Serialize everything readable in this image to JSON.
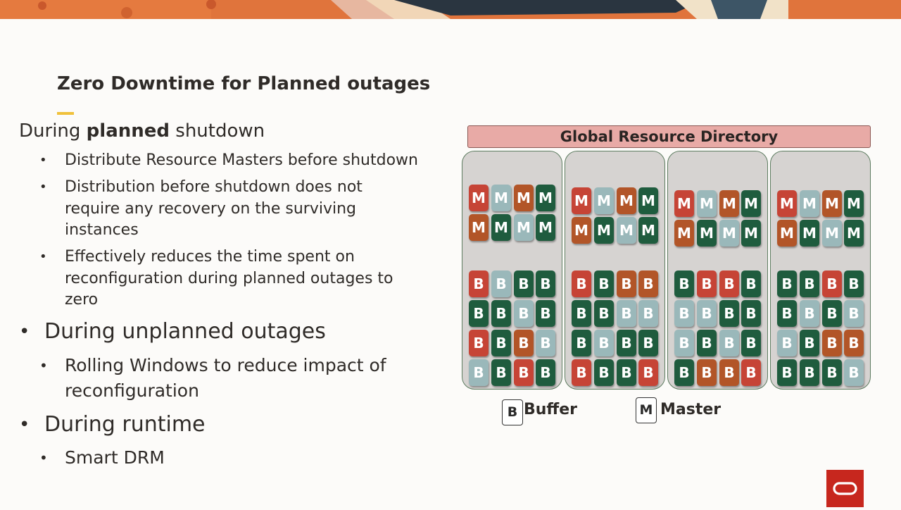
{
  "slide": {
    "title": "Zero Downtime for Planned outages",
    "lead_prefix": "During ",
    "lead_bold": "planned",
    "lead_suffix": " shutdown",
    "sub_bullets_planned": [
      "Distribute Resource Masters before shutdown",
      [
        "Distribution before shutdown does not",
        "require any recovery on the surviving",
        "instances"
      ],
      [
        "Effectively reduces the time spent on",
        "reconfiguration during planned outages to",
        "zero"
      ]
    ],
    "unplanned": "During unplanned outages",
    "unplanned_sub": [
      "Rolling Windows to reduce impact of",
      "reconfiguration"
    ],
    "runtime": "During runtime",
    "runtime_sub": "Smart DRM"
  },
  "diagram": {
    "header": "Global Resource Directory",
    "colors": {
      "red": "#c64436",
      "green": "#1f5c3e",
      "blue": "#9ab8ba",
      "orange": "#b25528"
    },
    "nodes": [
      {
        "masters": [
          [
            "red",
            "blue",
            "orange",
            "green"
          ],
          [
            "orange",
            "green",
            "blue",
            "green"
          ]
        ],
        "buffers": [
          [
            "red",
            "blue",
            "green",
            "green"
          ],
          [
            "green",
            "green",
            "blue",
            "green"
          ],
          [
            "red",
            "green",
            "orange",
            "blue"
          ],
          [
            "blue",
            "green",
            "red",
            "green"
          ]
        ]
      },
      {
        "masters": [
          [
            "red",
            "blue",
            "orange",
            "green"
          ],
          [
            "orange",
            "green",
            "blue",
            "green"
          ]
        ],
        "buffers": [
          [
            "red",
            "green",
            "orange",
            "orange"
          ],
          [
            "green",
            "green",
            "blue",
            "blue"
          ],
          [
            "green",
            "blue",
            "green",
            "green"
          ],
          [
            "red",
            "green",
            "green",
            "red"
          ]
        ]
      },
      {
        "masters": [
          [
            "red",
            "blue",
            "orange",
            "green"
          ],
          [
            "orange",
            "green",
            "blue",
            "green"
          ]
        ],
        "buffers": [
          [
            "green",
            "red",
            "red",
            "green"
          ],
          [
            "blue",
            "blue",
            "green",
            "green"
          ],
          [
            "blue",
            "green",
            "blue",
            "green"
          ],
          [
            "green",
            "orange",
            "orange",
            "red"
          ]
        ]
      },
      {
        "masters": [
          [
            "red",
            "blue",
            "orange",
            "green"
          ],
          [
            "orange",
            "green",
            "blue",
            "green"
          ]
        ],
        "buffers": [
          [
            "green",
            "green",
            "red",
            "green"
          ],
          [
            "green",
            "blue",
            "green",
            "blue"
          ],
          [
            "blue",
            "green",
            "orange",
            "orange"
          ],
          [
            "green",
            "green",
            "green",
            "blue"
          ]
        ]
      }
    ],
    "legend": {
      "buffer_letter": "B",
      "buffer_label": "Buffer",
      "master_letter": "M",
      "master_label": "Master"
    }
  }
}
